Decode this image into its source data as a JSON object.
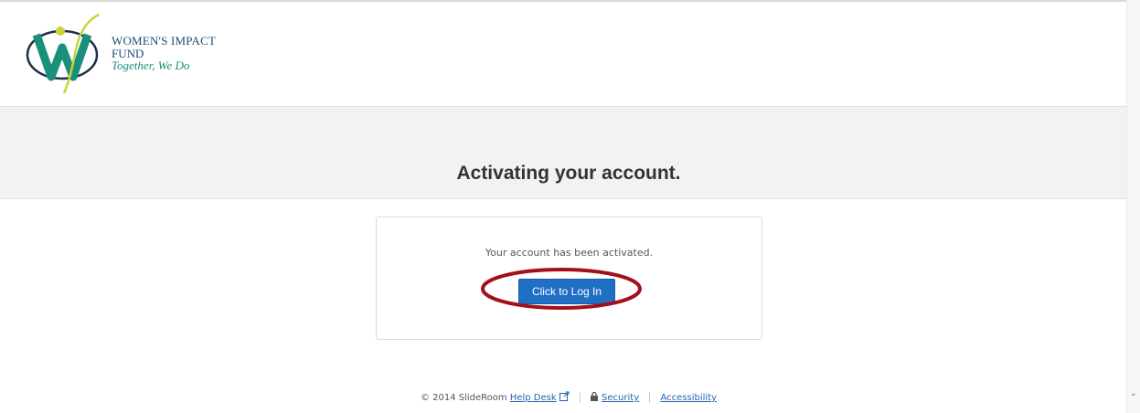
{
  "header": {
    "logo": {
      "line1": "WOMEN'S IMPACT",
      "line2": "FUND",
      "tagline": "Together, We Do"
    }
  },
  "hero": {
    "title": "Activating your account."
  },
  "card": {
    "message": "Your account has been activated.",
    "login_button": "Click to Log In"
  },
  "footer": {
    "copyright": "© 2014 SlideRoom",
    "help_desk": "Help Desk",
    "security": "Security",
    "accessibility": "Accessibility"
  },
  "colors": {
    "button": "#1f6fc5",
    "annotation": "#a3101a",
    "hero_bg": "#f2f2f2",
    "link": "#2463b3"
  }
}
